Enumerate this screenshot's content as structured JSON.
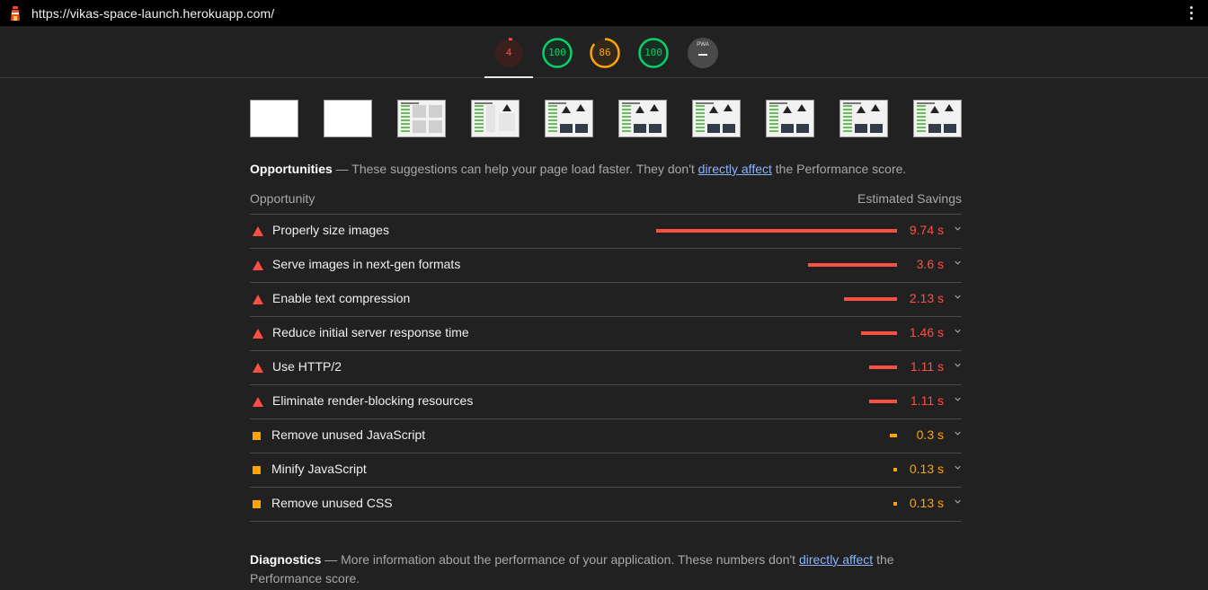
{
  "browser": {
    "url": "https://vikas-space-launch.herokuapp.com/"
  },
  "gauges": [
    {
      "value": "4",
      "score": 0.04,
      "color": "#ff4e42"
    },
    {
      "value": "100",
      "score": 1.0,
      "color": "#0cce6b"
    },
    {
      "value": "86",
      "score": 0.86,
      "color": "#ffa400"
    },
    {
      "value": "100",
      "score": 1.0,
      "color": "#0cce6b"
    },
    {
      "value": "PWA",
      "score": null,
      "color": "#4a4a4a"
    }
  ],
  "opportunities": {
    "heading": "Opportunities",
    "intro_before_link": " — These suggestions can help your page load faster. They don't ",
    "link_text": "directly affect",
    "intro_after_link": " the Performance score.",
    "col_opportunity": "Opportunity",
    "col_savings": "Estimated Savings",
    "items": [
      {
        "title": "Properly size images",
        "savings": "9.74 s",
        "seconds": 9.74,
        "severity": "fail"
      },
      {
        "title": "Serve images in next-gen formats",
        "savings": "3.6 s",
        "seconds": 3.6,
        "severity": "fail"
      },
      {
        "title": "Enable text compression",
        "savings": "2.13 s",
        "seconds": 2.13,
        "severity": "fail"
      },
      {
        "title": "Reduce initial server response time",
        "savings": "1.46 s",
        "seconds": 1.46,
        "severity": "fail"
      },
      {
        "title": "Use HTTP/2",
        "savings": "1.11 s",
        "seconds": 1.11,
        "severity": "fail"
      },
      {
        "title": "Eliminate render-blocking resources",
        "savings": "1.11 s",
        "seconds": 1.11,
        "severity": "fail"
      },
      {
        "title": "Remove unused JavaScript",
        "savings": "0.3 s",
        "seconds": 0.3,
        "severity": "average"
      },
      {
        "title": "Minify JavaScript",
        "savings": "0.13 s",
        "seconds": 0.13,
        "severity": "average"
      },
      {
        "title": "Remove unused CSS",
        "savings": "0.13 s",
        "seconds": 0.13,
        "severity": "average"
      }
    ]
  },
  "diagnostics": {
    "heading": "Diagnostics",
    "intro_before_link": " — More information about the performance of your application. These numbers don't ",
    "link_text": "directly affect",
    "intro_after_link": " the Performance score."
  },
  "colors": {
    "fail": "#ff4e42",
    "average": "#ffa400",
    "pass": "#0cce6b"
  }
}
